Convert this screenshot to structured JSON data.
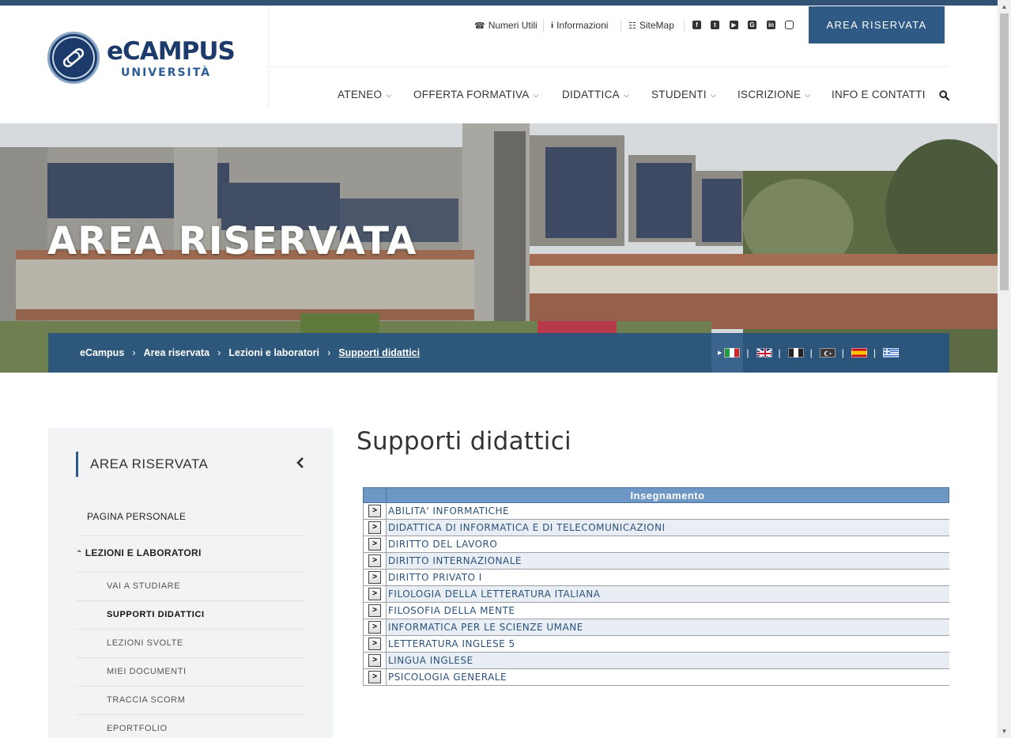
{
  "brand": {
    "name": "eCAMPUS",
    "sub": "UNIVERSITÀ"
  },
  "util": {
    "numeri": "Numeri Utili",
    "info": "Informazioni",
    "sitemap": "SiteMap",
    "area_btn": "AREA RISERVATA"
  },
  "social": [
    "facebook-icon",
    "twitter-icon",
    "youtube-icon",
    "googleplus-icon",
    "linkedin-icon",
    "instagram-icon"
  ],
  "nav": [
    "ATENEO",
    "OFFERTA FORMATIVA",
    "DIDATTICA",
    "STUDENTI",
    "ISCRIZIONE",
    "INFO E CONTATTI"
  ],
  "hero": {
    "title": "AREA RISERVATA"
  },
  "breadcrumb": [
    "eCampus",
    "Area riservata",
    "Lezioni e laboratori",
    "Supporti didattici"
  ],
  "languages": [
    "italian-flag",
    "english-flag",
    "french-flag",
    "turkish-flag",
    "spanish-flag",
    "greek-flag"
  ],
  "sidebar": {
    "title": "AREA RISERVATA",
    "items": [
      "PAGINA PERSONALE",
      "LEZIONI E LABORATORI"
    ],
    "sub": [
      "VAI A STUDIARE",
      "SUPPORTI DIDATTICI",
      "LEZIONI SVOLTE",
      "MIEI DOCUMENTI",
      "TRACCIA SCORM",
      "EPORTFOLIO"
    ]
  },
  "main": {
    "title": "Supporti didattici",
    "table": {
      "header": "Insegnamento",
      "button_label": ">",
      "rows": [
        "ABILITA' INFORMATICHE",
        "DIDATTICA DI INFORMATICA E DI TELECOMUNICAZIONI",
        "DIRITTO DEL LAVORO",
        "DIRITTO INTERNAZIONALE",
        "DIRITTO PRIVATO I",
        "FILOLOGIA DELLA LETTERATURA ITALIANA",
        "FILOSOFIA DELLA MENTE",
        "INFORMATICA PER LE SCIENZE UMANE",
        "LETTERATURA INGLESE 5",
        "LINGUA INGLESE",
        "PSICOLOGIA GENERALE"
      ]
    }
  },
  "colors": {
    "brand_navy": "#1d3b6a",
    "accent_blue": "#2f5a85",
    "table_header": "#6d97c4",
    "link": "#2b527c"
  }
}
